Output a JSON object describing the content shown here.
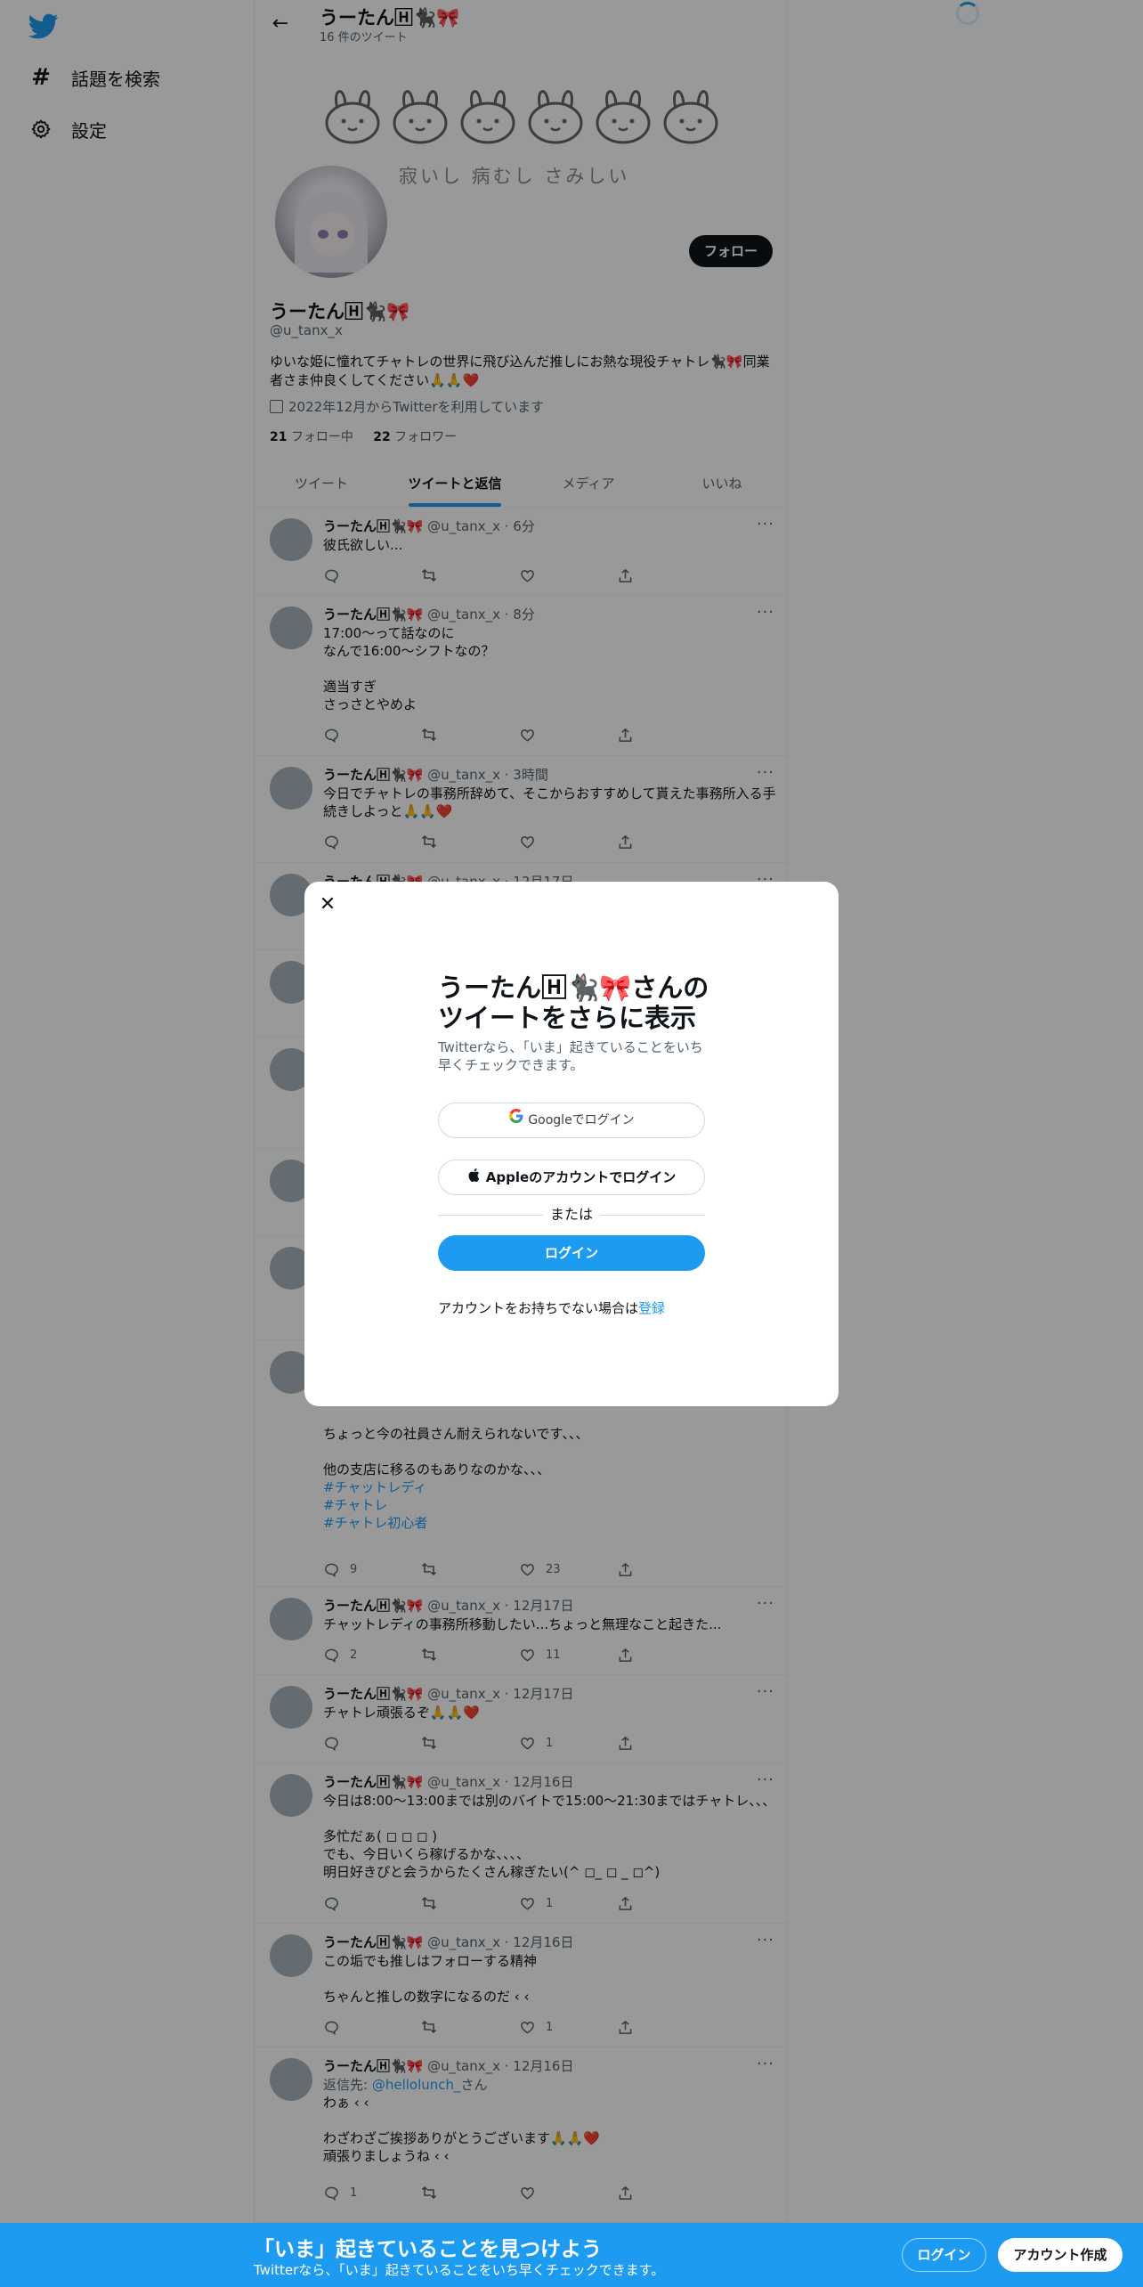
{
  "sidebar": {
    "items": [
      {
        "label": "話題を検索",
        "icon": "hashtag-icon"
      },
      {
        "label": "設定",
        "icon": "gear-icon"
      }
    ]
  },
  "header": {
    "name": "うーたん🄷🐈‍⬛🎀",
    "tweet_count": "16 件のツイート"
  },
  "profile": {
    "banner_text": "寂いし 病むし さみしい",
    "name": "うーたん🄷🐈‍⬛🎀",
    "handle": "@u_tanx_x",
    "bio": "ゆいな姫に憧れてチャトレの世界に飛び込んだ推しにお熱な現役チャトレ🐈‍⬛🎀同業者さま仲良くしてください🙏🙏❤️",
    "joined": "2022年12月からTwitterを利用しています",
    "following_count": "21",
    "following_label": "フォロー中",
    "followers_count": "22",
    "followers_label": "フォロワー",
    "follow_button": "フォロー"
  },
  "tabs": [
    "ツイート",
    "ツイートと返信",
    "メディア",
    "いいね"
  ],
  "tweets": [
    {
      "name": "うーたん🄷🐈‍⬛🎀",
      "meta": "@u_tanx_x · 6分",
      "text": "彼氏欲しい...",
      "replies": "",
      "likes": ""
    },
    {
      "name": "うーたん🄷🐈‍⬛🎀",
      "meta": "@u_tanx_x · 8分",
      "text": "17:00〜って話なのに\nなんで16:00〜シフトなの？\n\n適当すぎ\nさっさとやめよ",
      "replies": "",
      "likes": ""
    },
    {
      "name": "うーたん🄷🐈‍⬛🎀",
      "meta": "@u_tanx_x · 3時間",
      "text": "今日でチャトレの事務所辞めて、そこからおすすめして貰えた事務所入る手続きしよっと🙏🙏❤️",
      "replies": "",
      "likes": ""
    },
    {
      "name": "うーたん🄷🐈‍⬛🎀",
      "meta": "@u_tanx_x · 12月17日",
      "text": "",
      "replies": "",
      "likes": ""
    },
    {
      "text": "ちょっと今の社員さん耐えられないです、、、\n\n他の支店に移るのもありなのかな、、、",
      "tags": [
        "#チャットレディ",
        "#チャトレ",
        "#チャトレ初心者"
      ],
      "replies": "9",
      "likes": "23"
    },
    {
      "name": "うーたん🄷🐈‍⬛🎀",
      "meta": "@u_tanx_x · 12月17日",
      "text": "チャットレディの事務所移動したい...ちょっと無理なこと起きた...",
      "replies": "2",
      "likes": "11"
    },
    {
      "name": "うーたん🄷🐈‍⬛🎀",
      "meta": "@u_tanx_x · 12月17日",
      "text": "チャトレ頑張るぞ🙏🙏❤️",
      "replies": "",
      "likes": "1"
    },
    {
      "name": "うーたん🄷🐈‍⬛🎀",
      "meta": "@u_tanx_x · 12月16日",
      "text": "今日は8:00〜13:00までは別のバイトで15:00〜21:30まではチャトレ、、、\n\n多忙だぁ( ◻︎ ◻︎ ◻︎ )\nでも、今日いくら稼げるかな、、、、\n明日好きぴと会うからたくさん稼ぎたい(^ ◻︎_ ◻︎ _ ◻︎^)",
      "replies": "",
      "likes": "1"
    },
    {
      "name": "うーたん🄷🐈‍⬛🎀",
      "meta": "@u_tanx_x · 12月16日",
      "text": "この垢でも推しはフォローする精神\n\nちゃんと推しの数字になるのだ ‹ ‹",
      "replies": "",
      "likes": "1"
    },
    {
      "name": "うーたん🄷🐈‍⬛🎀",
      "meta": "@u_tanx_x · 12月16日",
      "reply_to_label": "返信先: ",
      "reply_to": "@hellolunch_",
      "reply_suffix": "さん",
      "text": "わぁ ‹ ‹\n\nわざわざご挨拶ありがとうございます🙏🙏❤️\n頑張りましょうね ‹ ‹",
      "replies": "1",
      "likes": ""
    }
  ],
  "modal": {
    "title": "うーたん🄷🐈‍⬛🎀さんのツイートをさらに表示",
    "subtitle": "Twitterなら、「いま」起きていることをいち早くチェックできます。",
    "google_button": "Googleでログイン",
    "apple_button": "Appleのアカウントでログイン",
    "or": "または",
    "login_button": "ログイン",
    "signup_prompt": "アカウントをお持ちでない場合は",
    "signup_link": "登録"
  },
  "bottom_bar": {
    "title": "「いま」起きていることを見つけよう",
    "subtitle": "Twitterなら、「いま」起きていることをいち早くチェックできます。",
    "login": "ログイン",
    "signup": "アカウント作成"
  },
  "colors": {
    "accent": "#1d9bf0",
    "text": "#0f1419",
    "muted": "#536471"
  }
}
